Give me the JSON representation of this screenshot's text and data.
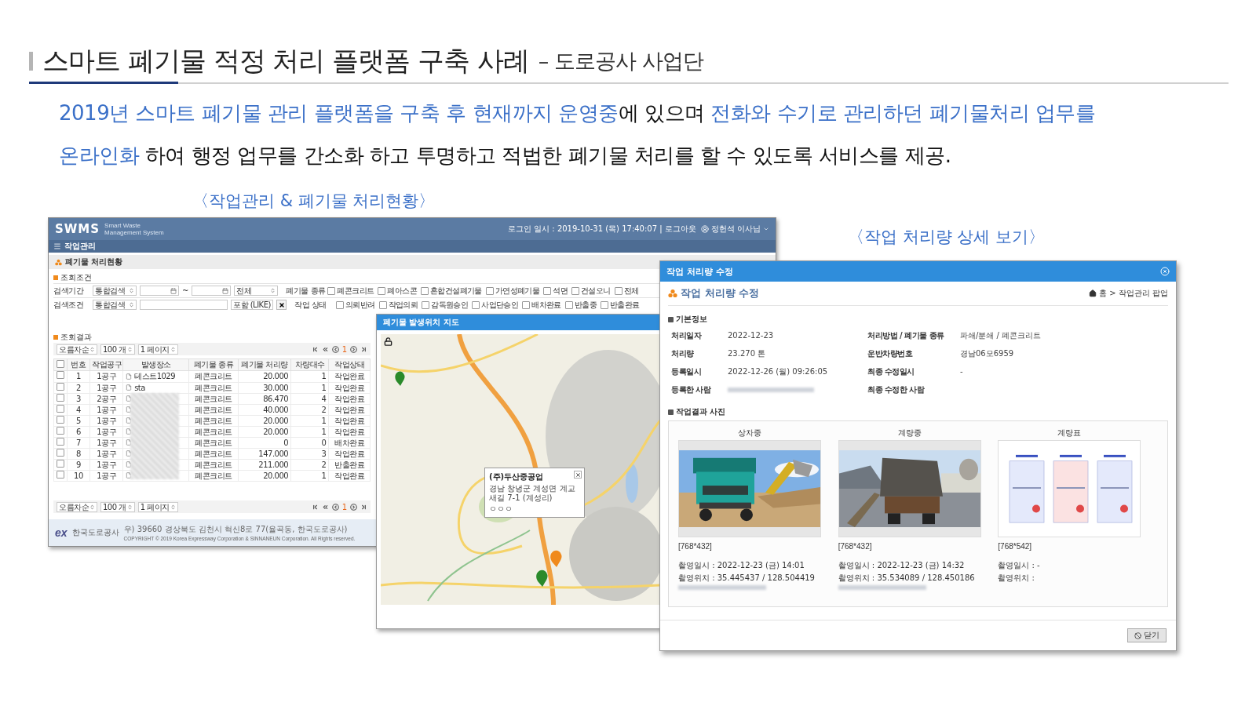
{
  "slide": {
    "title": "스마트 폐기물 적정 처리 플랫폼 구축 사례",
    "subtitle": "– 도로공사 사업단",
    "intro_lines": [
      [
        {
          "text": "2019년 스마트 폐기물 관리 플랫폼을 구축 후 현재까지 운영중",
          "highlight": true
        },
        {
          "text": "에 있으며 ",
          "highlight": false
        },
        {
          "text": "전화와 수기로 관리하던 폐기물처리 업무를",
          "highlight": true
        }
      ],
      [
        {
          "text": "온라인화",
          "highlight": true
        },
        {
          "text": " 하여 행정 업무를 간소화 하고 투명하고 적법한 폐기물 처리를 할 수 있도록 서비스를 제공.",
          "highlight": false
        }
      ]
    ]
  },
  "main_window": {
    "caption": "〈작업관리 & 폐기물 처리현황〉",
    "logo": "SWMS",
    "logo_sub": "Smart Waste Management System",
    "login_info": "로그인 일시 : 2019-10-31 (목) 17:40:07 | 로그아웃",
    "user": "정헌석 이사님",
    "nav": "작업관리",
    "page_title": "폐기물 처리현황",
    "search_title": "조회조건",
    "search_rows": [
      {
        "label": "검색기간",
        "controls": [
          {
            "kind": "select",
            "value": "통합검색"
          },
          {
            "kind": "date"
          },
          {
            "kind": "sep",
            "value": "~"
          },
          {
            "kind": "date"
          },
          {
            "kind": "select",
            "value": "전체"
          }
        ]
      },
      {
        "label": "검색조건",
        "controls": [
          {
            "kind": "select",
            "value": "통합검색"
          },
          {
            "kind": "input"
          },
          {
            "kind": "select",
            "value": "포함 (LIKE)"
          },
          {
            "kind": "clear"
          }
        ]
      }
    ],
    "filters": [
      {
        "label": "폐기물 종류",
        "options": [
          {
            "label": "폐콘크리트",
            "checked": false
          },
          {
            "label": "폐아스콘",
            "checked": false
          },
          {
            "label": "혼합건설폐기물",
            "checked": false
          },
          {
            "label": "가연성폐기물",
            "checked": false
          },
          {
            "label": "석면",
            "checked": false
          },
          {
            "label": "건설오니",
            "checked": false
          },
          {
            "label": "전체",
            "checked": false
          }
        ]
      },
      {
        "label": "작업 상태",
        "options": [
          {
            "label": "의뢰반려",
            "checked": false
          },
          {
            "label": "작업의뢰",
            "checked": false
          },
          {
            "label": "감독원승인",
            "checked": false
          },
          {
            "label": "사업단승인",
            "checked": false
          },
          {
            "label": "배차완료",
            "checked": false
          },
          {
            "label": "반출중",
            "checked": false
          },
          {
            "label": "반출완료",
            "checked": false
          }
        ]
      }
    ],
    "results_title": "조회결과",
    "pager_top": {
      "order": "오름차순",
      "per_page": "100 개",
      "page": "1 페이지",
      "current": "1"
    },
    "table": {
      "all_checked": false,
      "columns": [
        "번호",
        "작업공구",
        "발생장소",
        "폐기물 종류",
        "폐기물 처리량",
        "차량대수",
        "작업상태"
      ],
      "rows": [
        {
          "checked": false,
          "no": "1",
          "section": "1공구",
          "place": "테스트1029",
          "type": "폐콘크리트",
          "amount": "20.000",
          "vehicles": "1",
          "status": "작업완료"
        },
        {
          "checked": false,
          "no": "2",
          "section": "1공구",
          "place": "sta",
          "type": "폐콘크리트",
          "amount": "30.000",
          "vehicles": "1",
          "status": "작업완료"
        },
        {
          "checked": false,
          "no": "3",
          "section": "2공구",
          "type": "폐콘크리트",
          "amount": "86.470",
          "vehicles": "4",
          "status": "작업완료"
        },
        {
          "checked": false,
          "no": "4",
          "section": "1공구",
          "type": "폐콘크리트",
          "amount": "40.000",
          "vehicles": "2",
          "status": "작업완료"
        },
        {
          "checked": false,
          "no": "5",
          "section": "1공구",
          "type": "폐콘크리트",
          "amount": "20.000",
          "vehicles": "1",
          "status": "작업완료"
        },
        {
          "checked": false,
          "no": "6",
          "section": "1공구",
          "type": "폐콘크리트",
          "amount": "20.000",
          "vehicles": "1",
          "status": "작업완료"
        },
        {
          "checked": false,
          "no": "7",
          "section": "1공구",
          "type": "폐콘크리트",
          "amount": "0",
          "vehicles": "0",
          "status": "배차완료"
        },
        {
          "checked": false,
          "no": "8",
          "section": "1공구",
          "type": "폐콘크리트",
          "amount": "147.000",
          "vehicles": "3",
          "status": "작업완료"
        },
        {
          "checked": false,
          "no": "9",
          "section": "1공구",
          "type": "폐콘크리트",
          "amount": "211.000",
          "vehicles": "2",
          "status": "반출완료"
        },
        {
          "checked": false,
          "no": "10",
          "section": "1공구",
          "type": "폐콘크리트",
          "amount": "20.000",
          "vehicles": "1",
          "status": "작업완료"
        }
      ]
    },
    "pager_bottom": {
      "order": "오름차순",
      "per_page": "100 개",
      "page": "1 페이지",
      "current": "1"
    },
    "footer": {
      "logo_mark": "ex",
      "org": "한국도로공사",
      "address": "우) 39660 경상북도 김천시 혁신8로 77(율곡동, 한국도로공사)",
      "copyright": "COPYRIGHT © 2019 Korea Expressway Corporation & SINNANEUN Corporation. All Rights reserved."
    }
  },
  "map_window": {
    "title": "폐기물 발생위치 지도",
    "popup": {
      "name": "(주)두산중공업",
      "address": "경남 창녕군 계성면 계교새길 7-1 (계성리)",
      "note": "ㅇㅇㅇ"
    }
  },
  "detail_dialog": {
    "caption": "〈작업 처리량 상세 보기〉",
    "title": "작업 처리량 수정",
    "heading": "작업 처리량 수정",
    "breadcrumb": "홈 > 작업관리 팝업",
    "basic_title": "기본정보",
    "field_rows": [
      [
        {
          "label": "처리일자",
          "value": "2022-12-23"
        },
        {
          "label": "처리방법 / 폐기물 종류",
          "value": "파쇄/분쇄 / 폐콘크리트"
        }
      ],
      [
        {
          "label": "처리량",
          "value": "23.270 톤"
        },
        {
          "label": "운반차량번호",
          "value": "경남06모6959"
        }
      ],
      [
        {
          "label": "등록일시",
          "value": "2022-12-26 (월) 09:26:05"
        },
        {
          "label": "최종 수정일시",
          "value": "-"
        }
      ],
      [
        {
          "label": "등록한 사람",
          "redacted": true
        },
        {
          "label": "최종 수정한 사람"
        }
      ]
    ],
    "photos_title": "작업결과 사진",
    "photos": [
      {
        "label": "상차중",
        "size": "[768*432]",
        "lines": [
          "촬영일시 :  2022-12-23 (금) 14:01",
          "촬영위치 : 35.445437 / 128.504419"
        ],
        "redacted": true
      },
      {
        "label": "계량중",
        "size": "[768*432]",
        "lines": [
          "촬영일시 :  2022-12-23 (금) 14:32",
          "촬영위치 : 35.534089 / 128.450186"
        ],
        "redacted": true
      },
      {
        "label": "계량표",
        "size": "[768*542]",
        "lines": [
          "촬영일시 :  -",
          "촬영위치 :"
        ]
      }
    ],
    "close_button": "닫기"
  }
}
